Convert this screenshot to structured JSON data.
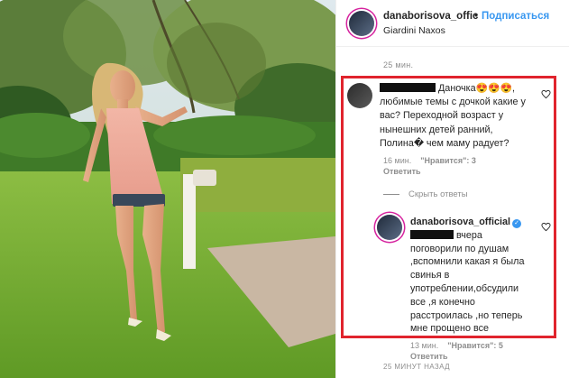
{
  "post": {
    "username": "danaborisova_offic",
    "follow_label": "Подписаться",
    "follow_separator": "•",
    "location": "Giardini Naxos",
    "caption_time": "25 мин.",
    "timestamp_footer": "25 МИНУТ НАЗАД"
  },
  "comment": {
    "lines": [
      "Даночка😍😍😍,",
      "любимые темы с дочкой какие у",
      "вас? Переходной возраст у",
      "нынешних детей ранний,",
      "Полина� чем маму радует?"
    ],
    "time": "16 мин.",
    "likes": "\"Нравится\": 3",
    "reply_label": "Ответить",
    "hide_replies": "Скрыть ответы"
  },
  "reply": {
    "username": "danaborisova_official",
    "verified_mark": "✓",
    "lines": [
      "вчера",
      "поговорили по душам",
      ",вспомнили какая я была",
      "свинья в",
      "употреблении,обсудили",
      "все ,я конечно",
      "расстроилась ,но теперь",
      "мне прощено все"
    ],
    "time": "13 мин.",
    "likes": "\"Нравится\": 5",
    "reply_label": "Ответить"
  },
  "colors": {
    "link_blue": "#3897f0",
    "highlight_red": "#e0242d",
    "muted_gray": "#8e8e8e"
  },
  "icons": [
    "heart-icon",
    "verified-badge-icon"
  ]
}
